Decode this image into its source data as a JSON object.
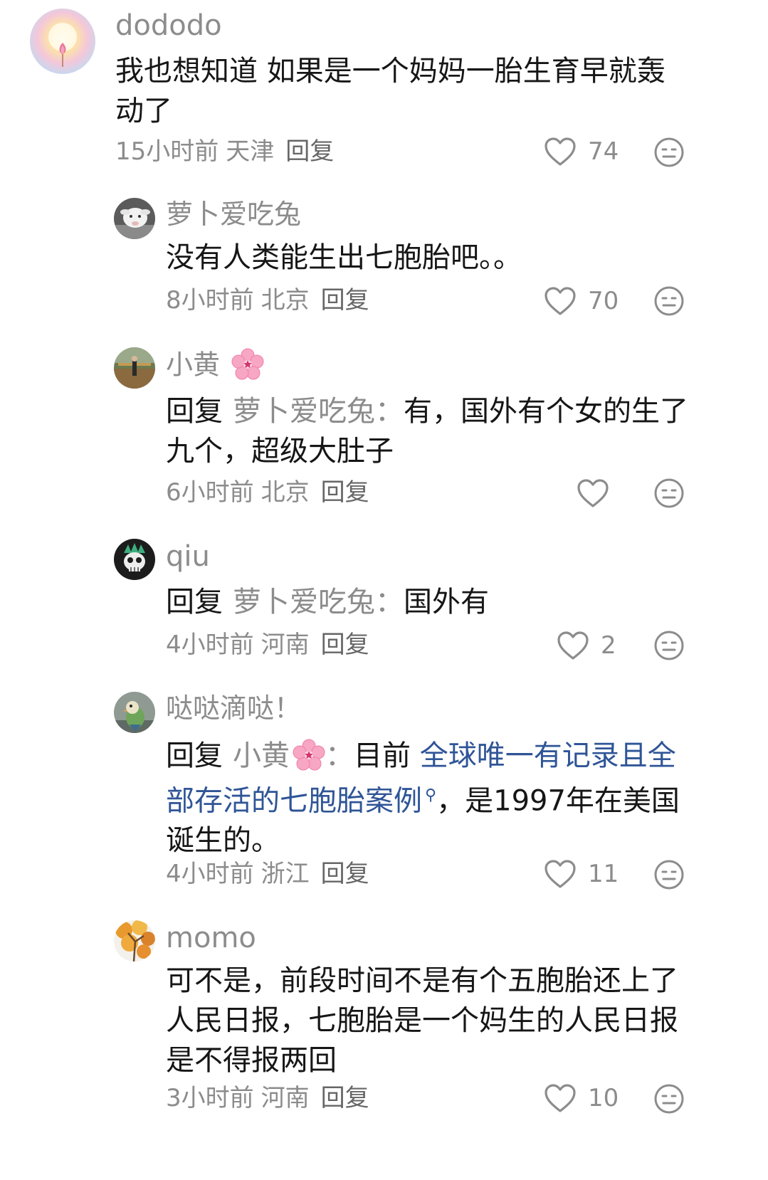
{
  "comments": [
    {
      "username": "dododo",
      "text": "我也想知道 如果是一个妈妈一胎生育早就轰动了",
      "time": "15小时前",
      "location": "天津",
      "reply_label": "回复",
      "likes": "74",
      "avatar_icon": "avatar-lotus-icon"
    },
    {
      "username": "萝卜爱吃兔",
      "text": "没有人类能生出七胞胎吧。。",
      "time": "8小时前",
      "location": "北京",
      "reply_label": "回复",
      "likes": "70",
      "avatar_icon": "avatar-lamb-icon"
    },
    {
      "username": "小黄",
      "reply_prefix": "回复",
      "reply_to": "萝卜爱吃兔：",
      "text": "有，国外有个女的生了九个，超级大肚子",
      "time": "6小时前",
      "location": "北京",
      "reply_label": "回复",
      "likes": "",
      "avatar_icon": "avatar-park-photo-icon"
    },
    {
      "username": "qiu",
      "reply_prefix": "回复",
      "reply_to": "萝卜爱吃兔：",
      "text": "国外有",
      "time": "4小时前",
      "location": "河南",
      "reply_label": "回复",
      "likes": "2",
      "avatar_icon": "avatar-skull-icon"
    },
    {
      "username": "哒哒滴哒！",
      "reply_prefix": "回复",
      "reply_to": "小黄",
      "reply_to_suffix": "：",
      "text_before": "目前 ",
      "link_text": "全球唯一有记录且全部存活的七胞胎案例",
      "text_after": "，是1997年在美国诞生的。",
      "time": "4小时前",
      "location": "浙江",
      "reply_label": "回复",
      "likes": "11",
      "avatar_icon": "avatar-parrot-icon"
    },
    {
      "username": "momo",
      "text": "可不是，前段时间不是有个五胞胎还上了人民日报，七胞胎是一个妈生的人民日报是不得报两回",
      "time": "3小时前",
      "location": "河南",
      "reply_label": "回复",
      "likes": "10",
      "avatar_icon": "avatar-autumn-tree-icon"
    }
  ],
  "colors": {
    "text": "#161616",
    "muted": "#8c8c8c",
    "link": "#2f5597"
  }
}
